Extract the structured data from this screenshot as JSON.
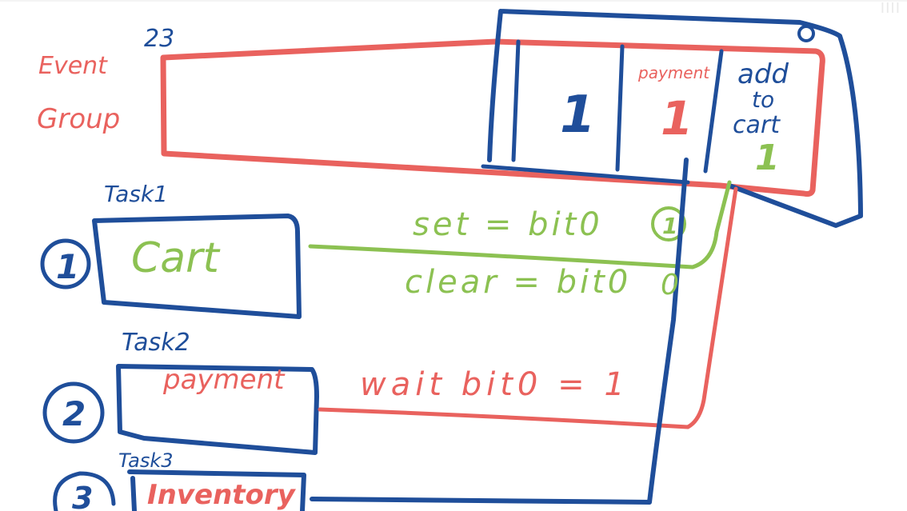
{
  "colors": {
    "blue": "#1f4e9a",
    "red": "#e9625e",
    "green": "#8cc152",
    "background": "#ffffff"
  },
  "group": {
    "label_line1": "Event",
    "label_line2": "Group",
    "bits_label": "23"
  },
  "bits": {
    "bit2_value": "1",
    "bit1_title": "payment",
    "bit1_value": "1",
    "bit0_title_line1": "add",
    "bit0_title_line2": "to",
    "bit0_title_line3": "cart",
    "bit0_value": "1"
  },
  "tasks": [
    {
      "number": "1",
      "title": "Task1",
      "body": "Cart"
    },
    {
      "number": "2",
      "title": "Task2",
      "body": "payment"
    },
    {
      "number": "3",
      "title": "Task3",
      "body": "Inventory"
    }
  ],
  "annotations": {
    "set": "set = bit0",
    "set_marker": "1",
    "clear": "clear = bit0",
    "clear_marker": "0",
    "wait": "wait bit0 = 1"
  },
  "corner_text": "IIII"
}
